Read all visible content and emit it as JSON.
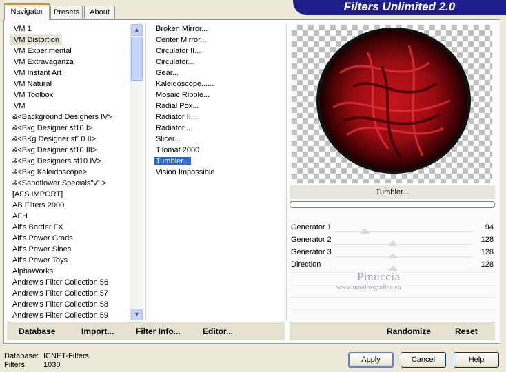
{
  "tabs": [
    {
      "label": "Navigator"
    },
    {
      "label": "Presets"
    },
    {
      "label": "About"
    }
  ],
  "header": {
    "title": "Filters Unlimited 2.0"
  },
  "categories": [
    {
      "label": "VM 1"
    },
    {
      "label": "VM Distortion"
    },
    {
      "label": "VM Experimental"
    },
    {
      "label": "VM Extravaganza"
    },
    {
      "label": "VM Instant Art"
    },
    {
      "label": "VM Natural"
    },
    {
      "label": "VM Toolbox"
    },
    {
      "label": "VM"
    },
    {
      "label": "&<Background Designers IV>"
    },
    {
      "label": "&<Bkg Designer sf10 I>"
    },
    {
      "label": "&<BKg Designer sf10 II>"
    },
    {
      "label": "&<Bkg Designer sf10 III>"
    },
    {
      "label": "&<Bkg Designers sf10 IV>"
    },
    {
      "label": "&<Bkg Kaleidoscope>"
    },
    {
      "label": "&<Sandflower Specials\"v\" >"
    },
    {
      "label": "[AFS IMPORT]"
    },
    {
      "label": "AB Filters 2000"
    },
    {
      "label": "AFH"
    },
    {
      "label": "Alf's Border FX"
    },
    {
      "label": "Alf's Power Grads"
    },
    {
      "label": "Alf's Power Sines"
    },
    {
      "label": "Alf's Power Toys"
    },
    {
      "label": "AlphaWorks"
    },
    {
      "label": "Andrew's Filter Collection 56"
    },
    {
      "label": "Andrew's Filter Collection 57"
    },
    {
      "label": "Andrew's Filter Collection 58"
    },
    {
      "label": "Andrew's Filter Collection 59"
    }
  ],
  "filters": [
    {
      "label": "Broken Mirror..."
    },
    {
      "label": "Center Mirror..."
    },
    {
      "label": "Circulator II..."
    },
    {
      "label": "Circulator..."
    },
    {
      "label": "Gear..."
    },
    {
      "label": "Kaleidoscope......"
    },
    {
      "label": "Mosaic Ripple..."
    },
    {
      "label": "Radial Pox..."
    },
    {
      "label": "Radiator II..."
    },
    {
      "label": "Radiator..."
    },
    {
      "label": "Slicer..."
    },
    {
      "label": "Tilomat 2000"
    },
    {
      "label": "Tumbler..."
    },
    {
      "label": "Vision Impossible"
    }
  ],
  "preview": {
    "filter_name": "Tumbler..."
  },
  "parameters": [
    {
      "label": "Generator 1",
      "value": "94"
    },
    {
      "label": "Generator 2",
      "value": "128"
    },
    {
      "label": "Generator 3",
      "value": "128"
    },
    {
      "label": "Direction",
      "value": "128"
    }
  ],
  "watermark": {
    "name": "Pinuccia",
    "url": "www.maidiregrafica.eu"
  },
  "left_buttons": {
    "database": "Database",
    "import": "Import...",
    "filter_info": "Filter Info...",
    "editor": "Editor..."
  },
  "right_buttons": {
    "randomize": "Randomize",
    "reset": "Reset"
  },
  "footer": {
    "database_label": "Database:",
    "database_value": "ICNET-Filters",
    "filters_label": "Filters:",
    "filters_value": "1030"
  },
  "dialog_buttons": {
    "apply": "Apply",
    "cancel": "Cancel",
    "help": "Help"
  },
  "colors": {
    "banner": "#1e1f8c",
    "selection": "#316ac5",
    "tab_accent": "#e68b2c"
  }
}
